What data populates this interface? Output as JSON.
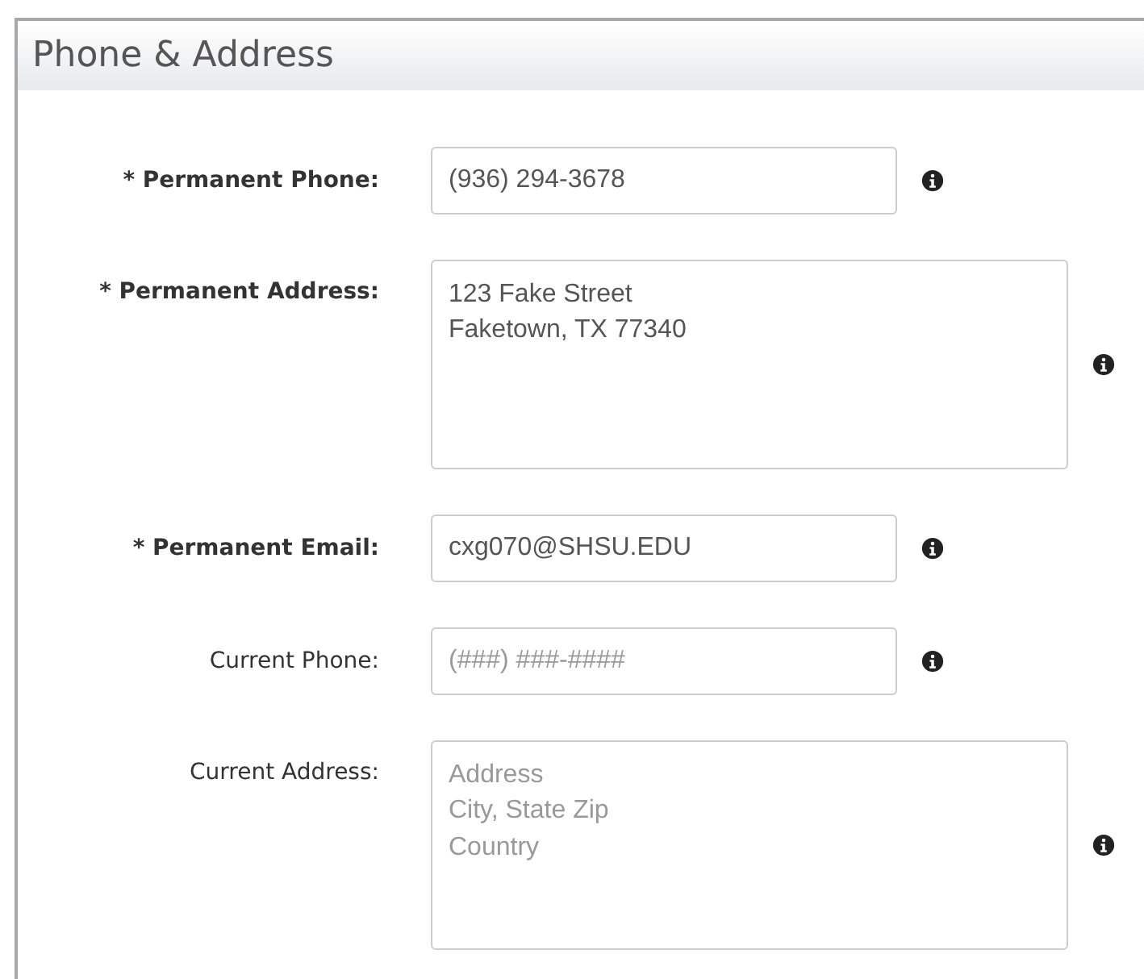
{
  "panel": {
    "title": "Phone & Address"
  },
  "fields": [
    {
      "label": "* Permanent Phone:",
      "required": true,
      "kind": "line",
      "value": "(936) 294-3678"
    },
    {
      "label": "* Permanent Address:",
      "required": true,
      "kind": "multiline",
      "value": "123 Fake Street\nFaketown, TX 77340"
    },
    {
      "label": "* Permanent Email:",
      "required": true,
      "kind": "line",
      "value": "cxg070@SHSU.EDU"
    },
    {
      "label": "Current Phone:",
      "required": false,
      "kind": "line",
      "placeholder": "(###) ###-####"
    },
    {
      "label": "Current Address:",
      "required": false,
      "kind": "multiline",
      "placeholder": "Address\nCity, State Zip\nCountry"
    }
  ]
}
